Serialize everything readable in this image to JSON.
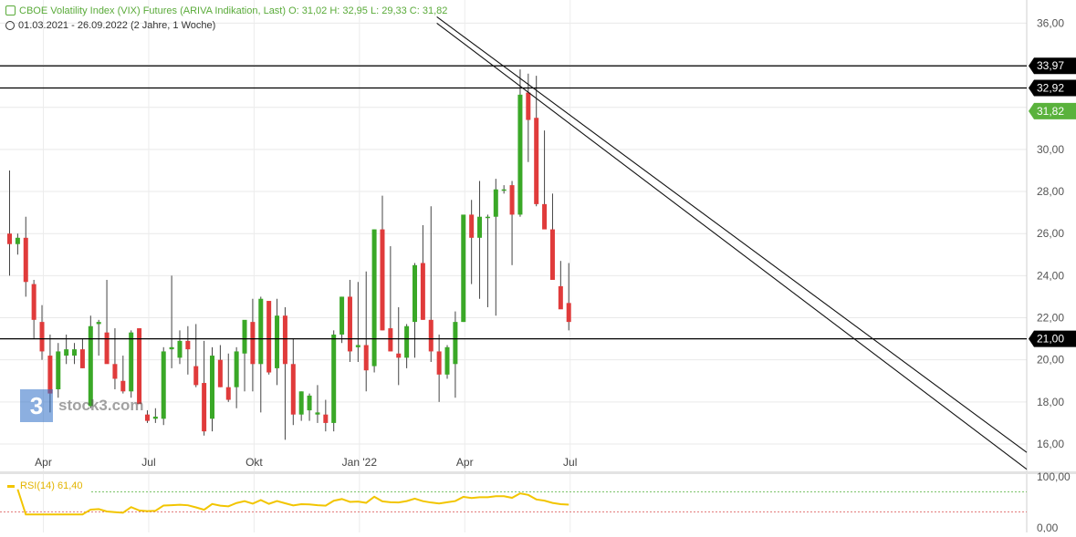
{
  "header": {
    "title_line": "CBOE Volatility Index (VIX) Futures (ARIVA Indikation, Last)  O: 31,02  H: 32,95  L: 29,33  C: 31,82",
    "range_line": "01.03.2021 - 26.09.2022   (2 Jahre, 1 Woche)"
  },
  "watermark": {
    "logo_glyph": "3",
    "text": "stock3.com"
  },
  "rsi": {
    "label": "RSI(14)  61,40",
    "axis_top": "100,00",
    "axis_bottom": "0,00"
  },
  "colors": {
    "up": "#3aa827",
    "down": "#e03b3b",
    "rsi_line": "#f2c500",
    "label_bg": "#000000",
    "last_price_bg": "#5ab23c"
  },
  "chart_data": {
    "type": "candlestick",
    "title": "CBOE Volatility Index (VIX) Futures (ARIVA Indikation, Last)",
    "ohlc_last": {
      "O": 31.02,
      "H": 32.95,
      "L": 29.33,
      "C": 31.82
    },
    "y_ticks": [
      "16,00",
      "18,00",
      "20,00",
      "22,00",
      "24,00",
      "26,00",
      "28,00",
      "30,00",
      "32,00",
      "34,00",
      "36,00"
    ],
    "y_tick_values": [
      16,
      18,
      20,
      22,
      24,
      26,
      28,
      30,
      32,
      34,
      36
    ],
    "ylim": [
      14.7,
      37.1
    ],
    "x_labels": [
      "Apr",
      "Jul",
      "Okt",
      "Jan '22",
      "Apr",
      "Jul"
    ],
    "x_label_week_index": [
      4,
      17,
      30,
      43,
      56,
      69
    ],
    "weeks": 82,
    "horizontal_levels": [
      {
        "value": 33.97,
        "label": "33,97"
      },
      {
        "value": 32.92,
        "label": "32,92"
      },
      {
        "value": 21.0,
        "label": "21,00"
      }
    ],
    "last_price": {
      "value": 31.82,
      "label": "31,82"
    },
    "trendlines": [
      {
        "from": [
          53,
          36.3
        ],
        "to": [
          140,
          15.6
        ]
      },
      {
        "from": [
          53,
          36.0
        ],
        "to": [
          140,
          14.8
        ]
      }
    ],
    "candles": [
      [
        26,
        29,
        24,
        25.5
      ],
      [
        25.5,
        26,
        25,
        25.8
      ],
      [
        25.8,
        26.8,
        23,
        23.7
      ],
      [
        23.6,
        23.8,
        21,
        21.9
      ],
      [
        21.8,
        22.6,
        20,
        20.4
      ],
      [
        20.2,
        21.2,
        17.5,
        18.4
      ],
      [
        18.6,
        20.8,
        18.2,
        20.4
      ],
      [
        20.2,
        21.2,
        19.8,
        20.5
      ],
      [
        20.2,
        20.8,
        19.8,
        20.5
      ],
      [
        20.5,
        21,
        19.6,
        19.6
      ],
      [
        17.8,
        22.1,
        17.7,
        21.6
      ],
      [
        21.7,
        21.9,
        20.2,
        21.8
      ],
      [
        21.3,
        23.8,
        19.9,
        19.8
      ],
      [
        19.8,
        21.5,
        18.6,
        19.1
      ],
      [
        19,
        20.2,
        18.4,
        18.5
      ],
      [
        18.5,
        21.4,
        18.2,
        21.3
      ],
      [
        21.5,
        21.5,
        17.9,
        17.9
      ],
      [
        17.4,
        17.6,
        17,
        17.1
      ],
      [
        17.2,
        17.7,
        17,
        17.3
      ],
      [
        17.2,
        20.6,
        16.9,
        20.4
      ],
      [
        20.5,
        24,
        19.6,
        20.6
      ],
      [
        20.1,
        21.4,
        19.8,
        20.9
      ],
      [
        20.9,
        21.6,
        19.3,
        20.5
      ],
      [
        19.7,
        21.7,
        18.7,
        18.8
      ],
      [
        18.9,
        20.9,
        16.4,
        16.6
      ],
      [
        17.2,
        20.6,
        16.6,
        20.2
      ],
      [
        20,
        20.7,
        18.7,
        18.7
      ],
      [
        18.7,
        20.3,
        18,
        18.1
      ],
      [
        18.7,
        20.6,
        17.7,
        20.4
      ],
      [
        20.3,
        21.8,
        18.5,
        21.9
      ],
      [
        21.8,
        22.9,
        18.5,
        19.8
      ],
      [
        19.8,
        23,
        17.5,
        22.9
      ],
      [
        22.8,
        22.7,
        19.3,
        19.4
      ],
      [
        19.6,
        22.9,
        18.8,
        22.1
      ],
      [
        22.1,
        22.5,
        16.2,
        19.8
      ],
      [
        19.8,
        21,
        16.9,
        17.4
      ],
      [
        17.4,
        18.5,
        17.1,
        18.5
      ],
      [
        17.6,
        18.4,
        17.1,
        18.3
      ],
      [
        17.4,
        18.8,
        17,
        17.5
      ],
      [
        17.4,
        18.1,
        16.6,
        17
      ],
      [
        17,
        21.4,
        16.6,
        21.2
      ],
      [
        21.2,
        23,
        20.8,
        23
      ],
      [
        23,
        23.8,
        19.9,
        20.4
      ],
      [
        20.6,
        23.7,
        19.9,
        20.7
      ],
      [
        20.7,
        24.2,
        18.5,
        19.5
      ],
      [
        19.7,
        26.2,
        19.4,
        26.2
      ],
      [
        26.2,
        27.8,
        21.4,
        21.4
      ],
      [
        21.5,
        25.4,
        20.4,
        20.4
      ],
      [
        20.3,
        22.5,
        18.8,
        20.1
      ],
      [
        20.1,
        21.7,
        19.6,
        21.6
      ],
      [
        21.8,
        24.6,
        20.1,
        24.5
      ],
      [
        24.6,
        26.4,
        21.9,
        21.9
      ],
      [
        21.9,
        27.3,
        19.9,
        20.4
      ],
      [
        20.4,
        21.2,
        18,
        19.3
      ],
      [
        19.3,
        20.7,
        19.1,
        20.6
      ],
      [
        19.8,
        22.3,
        18.2,
        21.8
      ],
      [
        21.8,
        25.8,
        21.8,
        26.9
      ],
      [
        26.9,
        27.6,
        23.6,
        25.8
      ],
      [
        25.8,
        28.5,
        22.9,
        26.8
      ],
      [
        26.8,
        26.9,
        22.5,
        26.8
      ],
      [
        26.8,
        28.6,
        22.1,
        28.1
      ],
      [
        28.1,
        28.3,
        27.9,
        28.1
      ],
      [
        28.3,
        28.5,
        24.5,
        26.9
      ],
      [
        26.9,
        33.8,
        26.8,
        32.6
      ],
      [
        32.7,
        33.6,
        29.4,
        31.4
      ],
      [
        31.5,
        33.5,
        27.3,
        27.4
      ],
      [
        27.4,
        30.9,
        26.6,
        26.2
      ],
      [
        26.2,
        27.9,
        24.1,
        23.8
      ],
      [
        23.5,
        24.7,
        22.7,
        22.4
      ],
      [
        22.7,
        24.6,
        21.4,
        21.8
      ]
    ]
  }
}
